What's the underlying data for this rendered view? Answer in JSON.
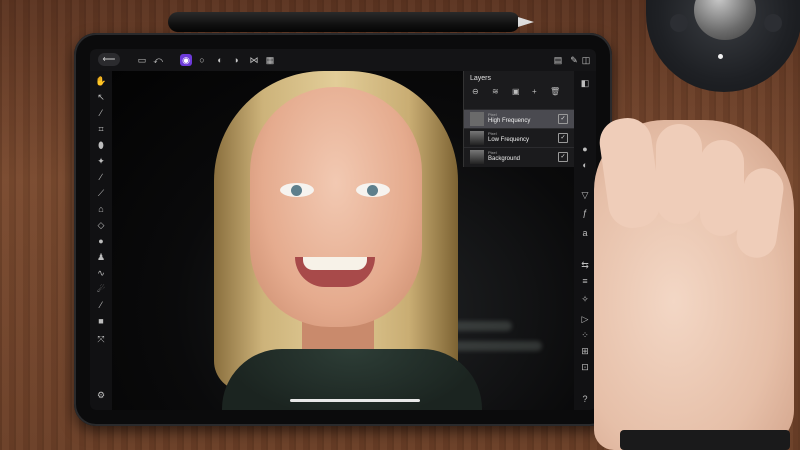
{
  "app": {
    "layers_panel": {
      "title": "Layers",
      "controls": [
        "⊖",
        "≋",
        "▣",
        "+",
        "🗑"
      ],
      "layers": [
        {
          "kind": "Pixel",
          "name": "High Frequency",
          "selected": true,
          "visible": true
        },
        {
          "kind": "Pixel",
          "name": "Low Frequency",
          "selected": false,
          "visible": true
        },
        {
          "kind": "Pixel",
          "name": "Background",
          "selected": false,
          "visible": true
        }
      ]
    },
    "toolbar": {
      "back": "⟵",
      "persona_icons": [
        "photo-persona-icon",
        "liquify-icon",
        "develop-icon",
        "tone-map-icon",
        "export-icon"
      ]
    },
    "bottom_right_help": "?"
  },
  "colors": {
    "accent": "#6d3ad9",
    "panel_bg": "#1c1c1e",
    "selected_row": "#4a4a50"
  }
}
